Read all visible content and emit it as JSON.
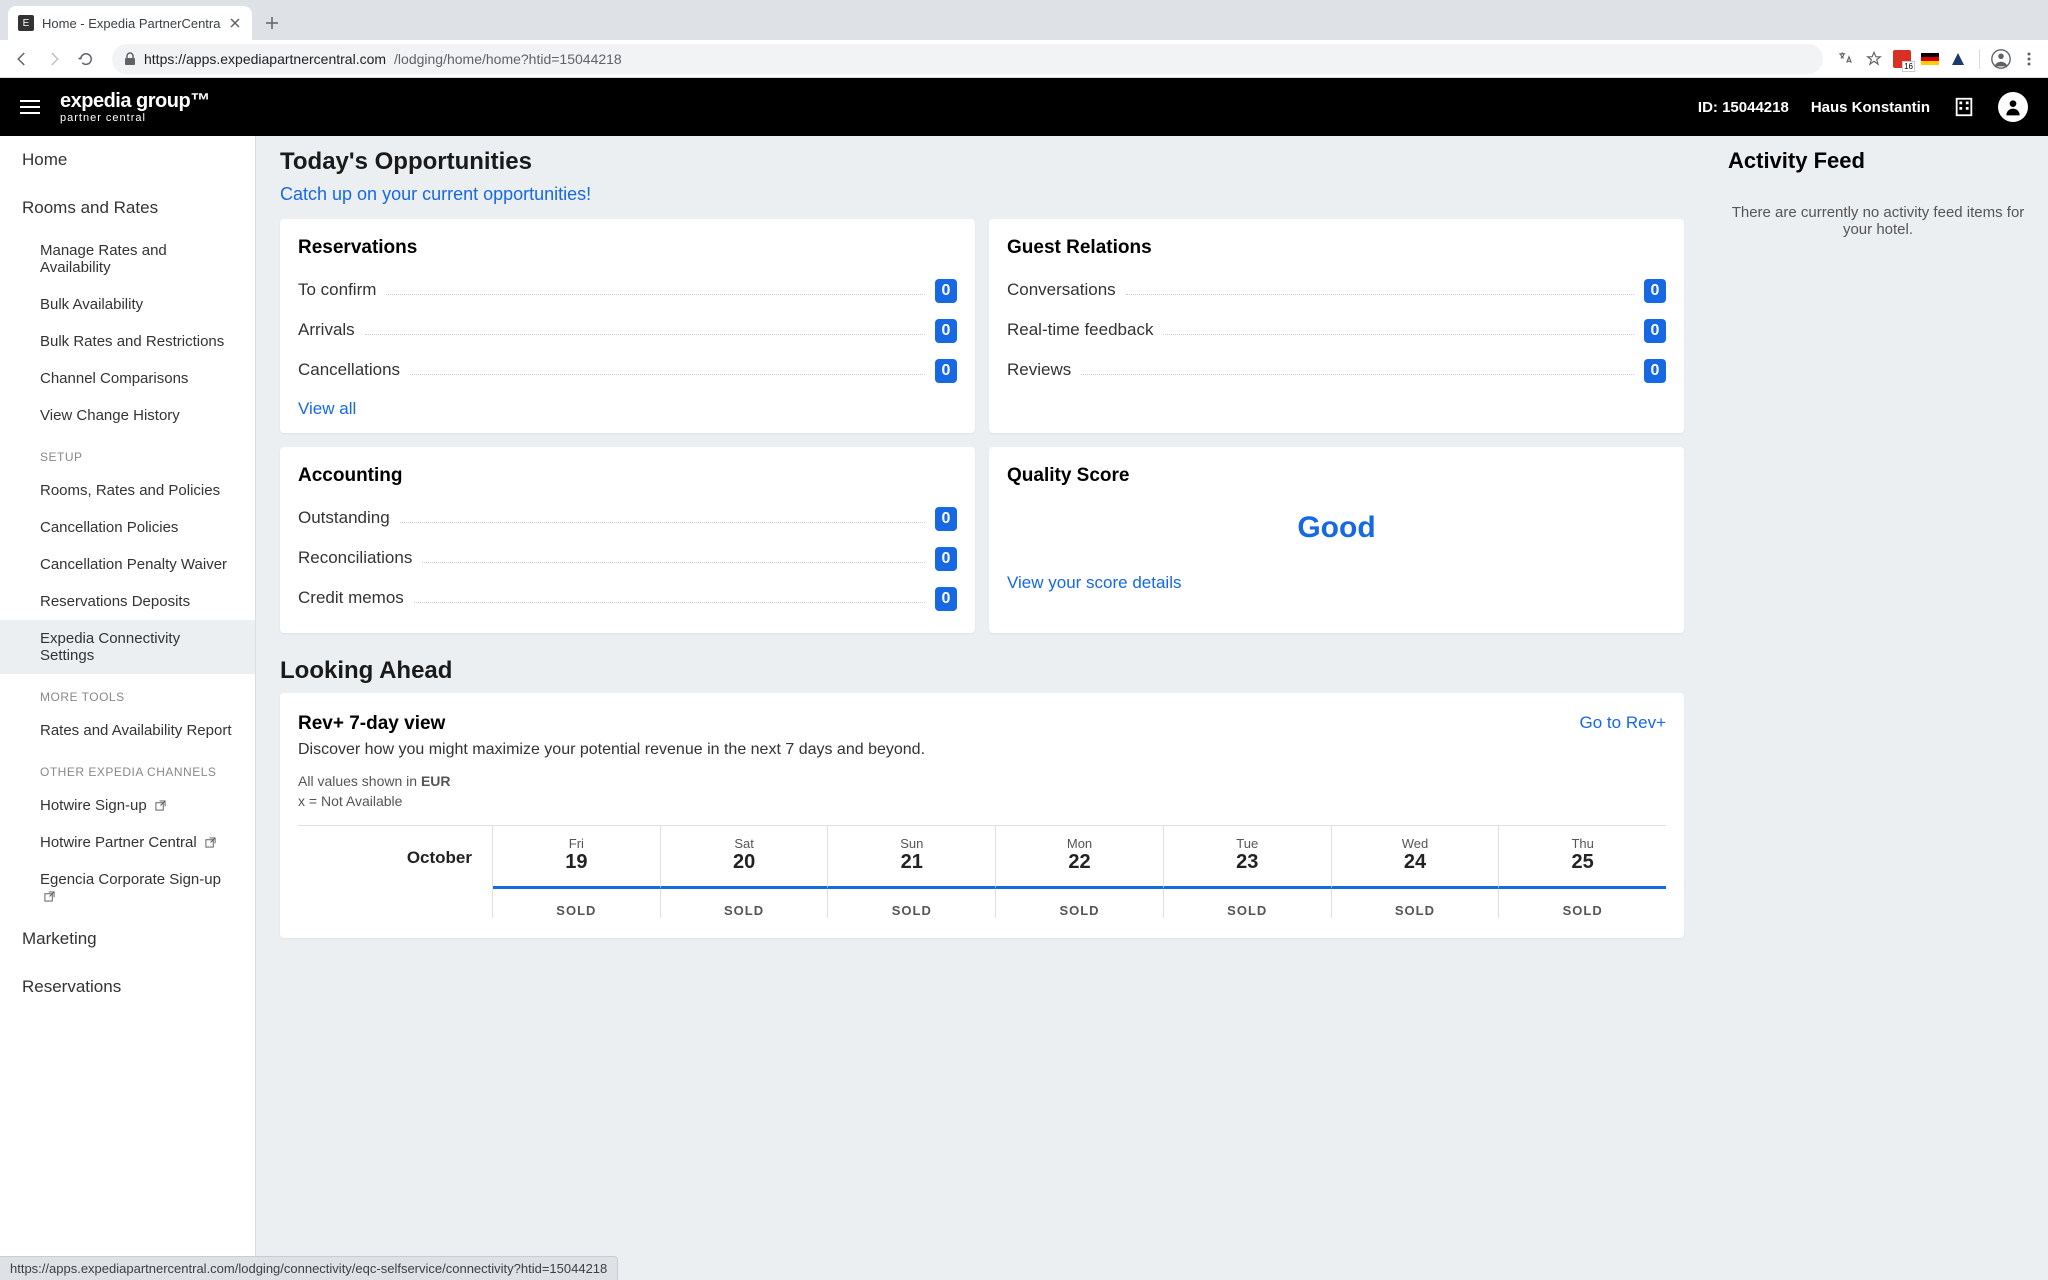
{
  "browser": {
    "tab_title": "Home - Expedia PartnerCentra",
    "url_host": "https://apps.expediapartnercentral.com",
    "url_path": "/lodging/home/home?htid=15044218",
    "status_url": "https://apps.expediapartnercentral.com/lodging/connectivity/eqc-selfservice/connectivity?htid=15044218",
    "ext_badge": "16"
  },
  "header": {
    "brand_top": "expedia group™",
    "brand_sub": "partner central",
    "id_label": "ID: 15044218",
    "property_name": "Haus Konstantin"
  },
  "sidebar": {
    "home": "Home",
    "rooms_rates": "Rooms and Rates",
    "subs1": [
      "Manage Rates and Availability",
      "Bulk Availability",
      "Bulk Rates and Restrictions",
      "Channel Comparisons",
      "View Change History"
    ],
    "setup_heading": "SETUP",
    "setup": [
      "Rooms, Rates and Policies",
      "Cancellation Policies",
      "Cancellation Penalty Waiver",
      "Reservations Deposits",
      "Expedia Connectivity Settings"
    ],
    "more_heading": "MORE TOOLS",
    "more": [
      "Rates and Availability Report"
    ],
    "other_heading": "OTHER EXPEDIA CHANNELS",
    "other": [
      "Hotwire Sign-up",
      "Hotwire Partner Central",
      "Egencia Corporate Sign-up"
    ],
    "marketing": "Marketing",
    "reservations": "Reservations"
  },
  "main": {
    "opportunities_title": "Today's Opportunities",
    "catchup": "Catch up on your current opportunities!",
    "reservations": {
      "title": "Reservations",
      "rows": [
        {
          "label": "To confirm",
          "val": "0"
        },
        {
          "label": "Arrivals",
          "val": "0"
        },
        {
          "label": "Cancellations",
          "val": "0"
        }
      ],
      "view_all": "View all"
    },
    "guest": {
      "title": "Guest Relations",
      "rows": [
        {
          "label": "Conversations",
          "val": "0"
        },
        {
          "label": "Real-time feedback",
          "val": "0"
        },
        {
          "label": "Reviews",
          "val": "0"
        }
      ]
    },
    "accounting": {
      "title": "Accounting",
      "rows": [
        {
          "label": "Outstanding",
          "val": "0"
        },
        {
          "label": "Reconciliations",
          "val": "0"
        },
        {
          "label": "Credit memos",
          "val": "0"
        }
      ]
    },
    "quality": {
      "title": "Quality Score",
      "value": "Good",
      "link": "View your score details"
    },
    "looking_title": "Looking Ahead",
    "rev": {
      "title": "Rev+ 7-day view",
      "link": "Go to Rev+",
      "desc": "Discover how you might maximize your potential revenue in the next 7 days and beyond.",
      "note_prefix": "All values shown in ",
      "note_currency": "EUR",
      "note2": "x = Not Available",
      "month": "October",
      "days": [
        {
          "dow": "Fri",
          "num": "19"
        },
        {
          "dow": "Sat",
          "num": "20"
        },
        {
          "dow": "Sun",
          "num": "21"
        },
        {
          "dow": "Mon",
          "num": "22"
        },
        {
          "dow": "Tue",
          "num": "23"
        },
        {
          "dow": "Wed",
          "num": "24"
        },
        {
          "dow": "Thu",
          "num": "25"
        }
      ],
      "sold": "SOLD"
    }
  },
  "activity": {
    "title": "Activity Feed",
    "empty": "There are currently no activity feed items for your hotel."
  }
}
